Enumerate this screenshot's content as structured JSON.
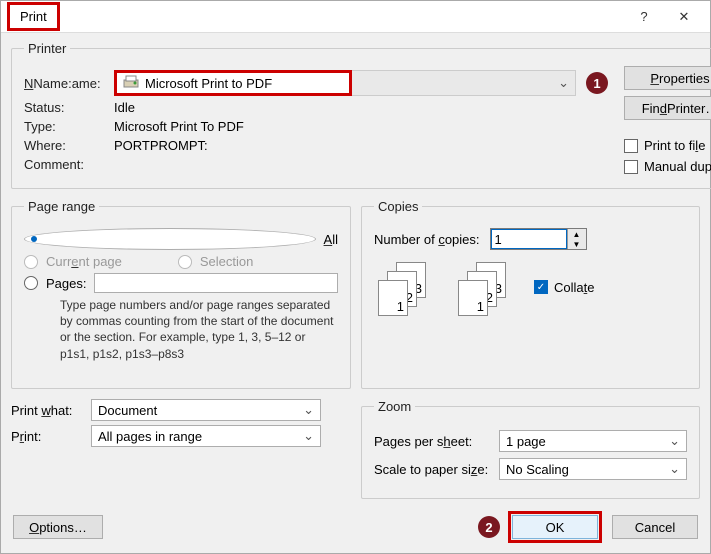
{
  "title": "Print",
  "help_char": "?",
  "close_char": "✕",
  "printer": {
    "legend": "Printer",
    "name_label": "Name:",
    "name_value": "Microsoft Print to PDF",
    "status_label": "Status:",
    "status_value": "Idle",
    "type_label": "Type:",
    "type_value": "Microsoft Print To PDF",
    "where_label": "Where:",
    "where_value": "PORTPROMPT:",
    "comment_label": "Comment:",
    "properties_btn": "Properties",
    "find_btn": "Find Printer…",
    "print_to_file": "Print to file",
    "manual_duplex": "Manual duplex"
  },
  "marker1": "1",
  "marker2": "2",
  "page_range": {
    "legend": "Page range",
    "all": "All",
    "current": "Current page",
    "selection": "Selection",
    "pages": "Pages:",
    "pages_input": "",
    "help": "Type page numbers and/or page ranges separated by commas counting from the start of the document or the section. For example, type 1, 3, 5–12 or p1s1, p1s2, p1s3–p8s3"
  },
  "copies": {
    "legend": "Copies",
    "num_label": "Number of copies:",
    "num_value": "1",
    "collate": "Collate"
  },
  "print_what_label": "Print what:",
  "print_what_value": "Document",
  "print_label": "Print:",
  "print_value": "All pages in range",
  "zoom": {
    "legend": "Zoom",
    "pps_label": "Pages per sheet:",
    "pps_value": "1 page",
    "scale_label": "Scale to paper size:",
    "scale_value": "No Scaling"
  },
  "options_btn": "Options…",
  "ok_btn": "OK",
  "cancel_btn": "Cancel"
}
